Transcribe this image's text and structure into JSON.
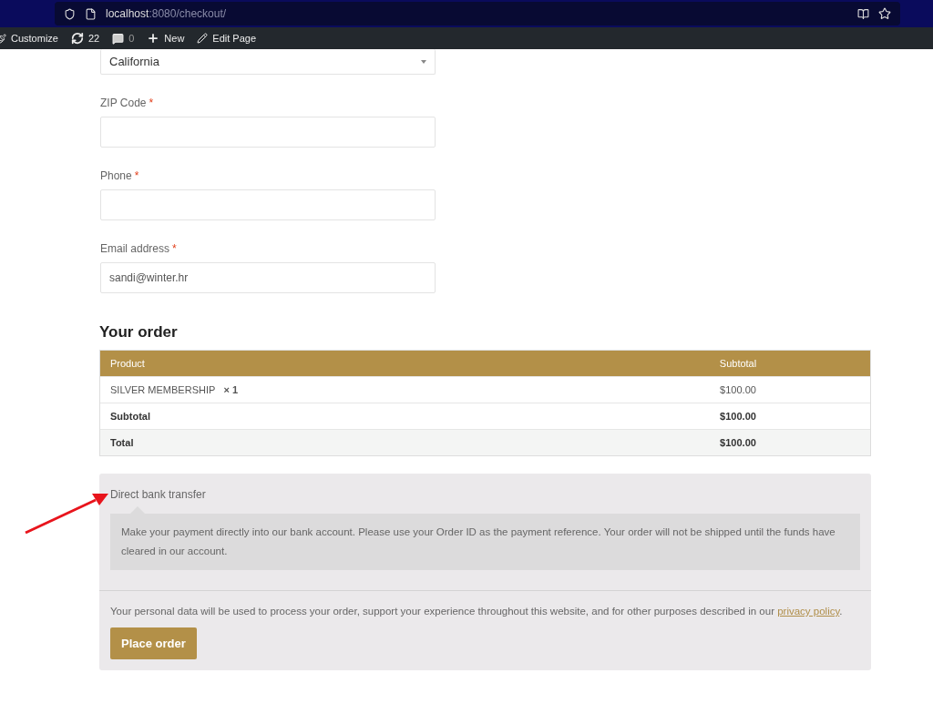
{
  "browser": {
    "url_host": "localhost",
    "url_path": ":8080/checkout/"
  },
  "admin_bar": {
    "items": [
      {
        "kind": "brush",
        "label": "Customize"
      },
      {
        "kind": "updates",
        "label": "22"
      },
      {
        "kind": "comments",
        "label": "0"
      },
      {
        "kind": "plus",
        "label": "New"
      },
      {
        "kind": "pencil",
        "label": "Edit Page"
      }
    ]
  },
  "form": {
    "fields": [
      {
        "kind": "select",
        "value": "California"
      },
      {
        "kind": "text",
        "label": "ZIP Code",
        "required_mark": "*"
      },
      {
        "kind": "text",
        "label": "Phone",
        "required_mark": "*"
      },
      {
        "kind": "text",
        "label": "Email address",
        "required_mark": "*",
        "value": "sandi@winter.hr"
      }
    ]
  },
  "order": {
    "heading": "Your order",
    "columns": [
      "Product",
      "Subtotal"
    ],
    "item": {
      "name": "SILVER MEMBERSHIP",
      "quantity": "× 1",
      "subtotal": "$100.00"
    },
    "totals": [
      {
        "label": "Subtotal",
        "value": "$100.00"
      },
      {
        "label": "Total",
        "value": "$100.00"
      }
    ]
  },
  "payment": {
    "method": "Direct bank transfer",
    "description": "Make your payment directly into our bank account. Please use your Order ID as the payment reference. Your order will not be shipped until the funds have cleared in our account.",
    "privacy_text": "Your personal data will be used to process your order, support your experience throughout this website, and for other purposes described in our ",
    "privacy_link": "privacy policy",
    "privacy_end": ".",
    "button": "Place order"
  }
}
